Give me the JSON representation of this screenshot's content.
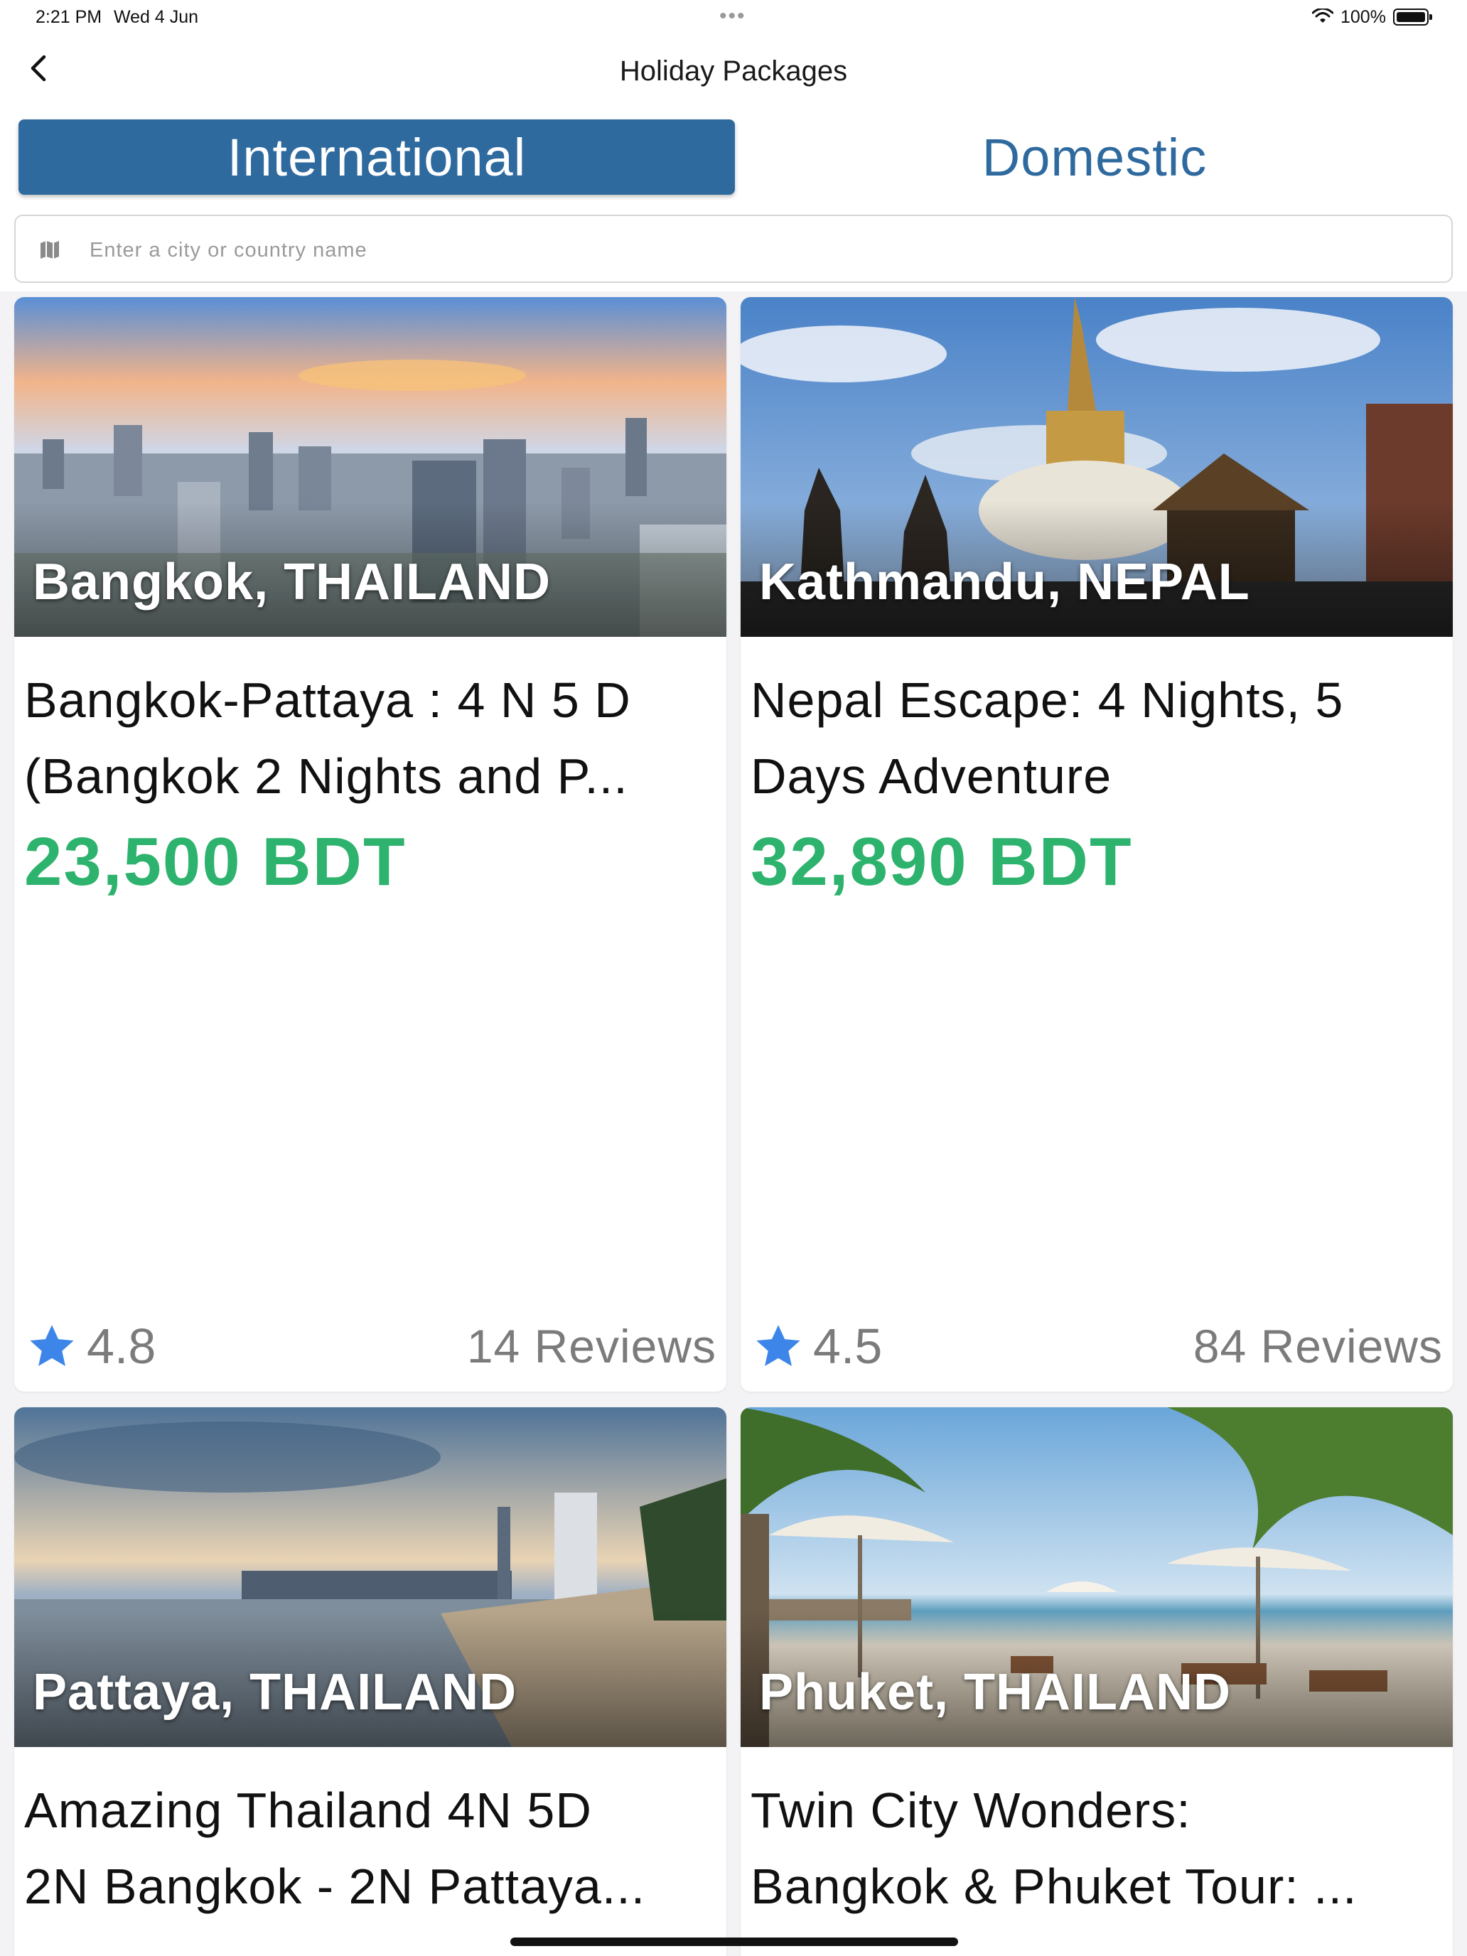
{
  "status_bar": {
    "time": "2:21 PM",
    "date": "Wed 4 Jun",
    "battery": "100%"
  },
  "nav": {
    "title": "Holiday Packages",
    "back_icon": "chevron-left-icon"
  },
  "tabs": [
    {
      "label": "International",
      "selected": true
    },
    {
      "label": "Domestic",
      "selected": false
    }
  ],
  "search": {
    "placeholder": "Enter a city or country name",
    "value": "",
    "icon": "map-icon"
  },
  "colors": {
    "accent": "#2f6a9f",
    "price": "#2db36d",
    "star": "#3d85e8",
    "muted": "#7b7b7b"
  },
  "packages": [
    {
      "location": "Bangkok, THAILAND",
      "title_line1": "Bangkok-Pattaya : 4 N 5 D",
      "title_line2": "(Bangkok 2 Nights and P...",
      "price": "23,500 BDT",
      "rating": "4.8",
      "reviews": "14 Reviews"
    },
    {
      "location": "Kathmandu, NEPAL",
      "title_line1": "Nepal Escape: 4 Nights, 5",
      "title_line2": "Days Adventure",
      "price": "32,890 BDT",
      "rating": "4.5",
      "reviews": "84 Reviews"
    },
    {
      "location": "Pattaya, THAILAND",
      "title_line1": "Amazing Thailand 4N 5D",
      "title_line2": "2N Bangkok - 2N Pattaya..."
    },
    {
      "location": "Phuket, THAILAND",
      "title_line1": "Twin City Wonders:",
      "title_line2": "Bangkok & Phuket Tour: ..."
    }
  ]
}
